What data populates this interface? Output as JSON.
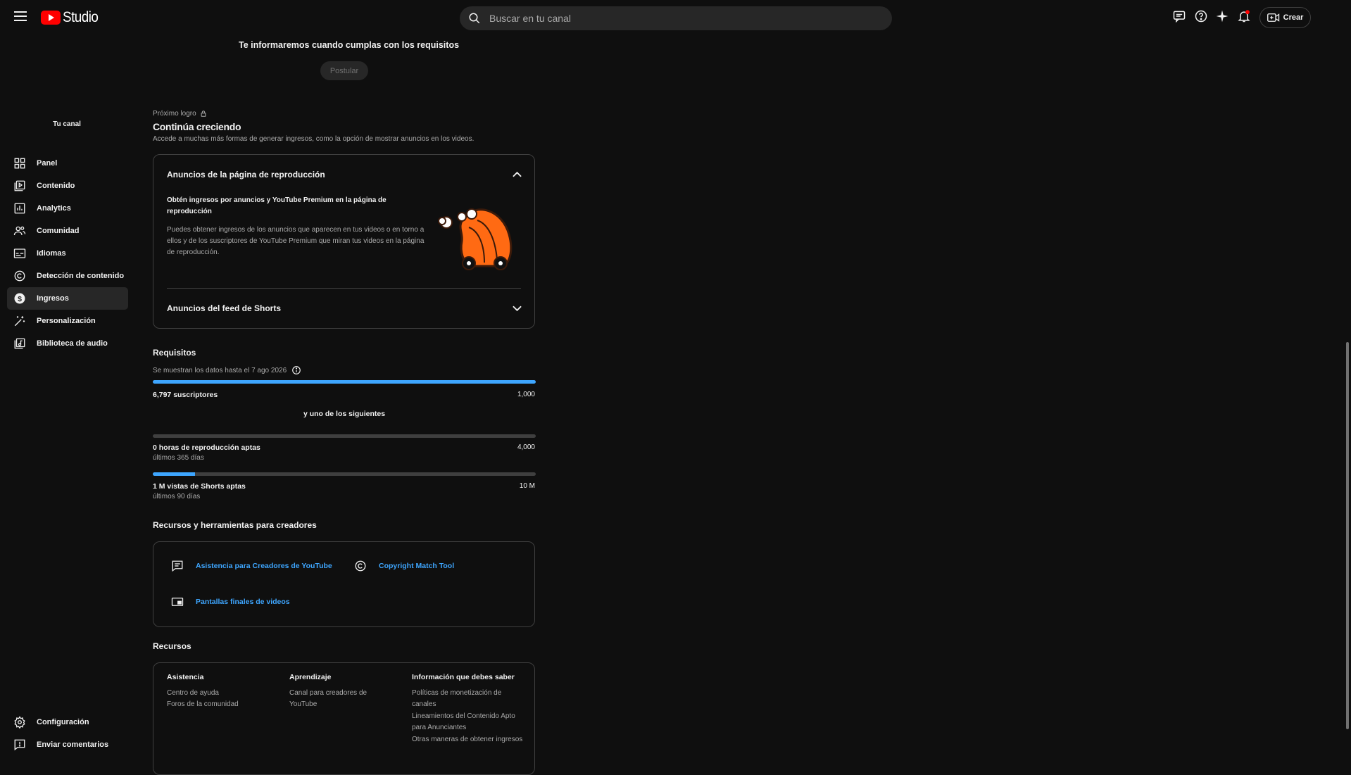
{
  "header": {
    "app_name": "Studio",
    "search_placeholder": "Buscar en tu canal",
    "create_label": "Crear"
  },
  "sidebar": {
    "channel_label": "Tu canal",
    "items": [
      {
        "label": "Panel",
        "icon": "dashboard-icon"
      },
      {
        "label": "Contenido",
        "icon": "content-icon"
      },
      {
        "label": "Analytics",
        "icon": "analytics-icon"
      },
      {
        "label": "Comunidad",
        "icon": "community-icon"
      },
      {
        "label": "Idiomas",
        "icon": "subtitles-icon"
      },
      {
        "label": "Detección de contenido",
        "icon": "copyright-icon"
      },
      {
        "label": "Ingresos",
        "icon": "dollar-icon"
      },
      {
        "label": "Personalización",
        "icon": "magic-wand-icon"
      },
      {
        "label": "Biblioteca de audio",
        "icon": "audio-library-icon"
      }
    ],
    "bottom": [
      {
        "label": "Configuración",
        "icon": "gear-icon"
      },
      {
        "label": "Enviar comentarios",
        "icon": "feedback-icon"
      }
    ]
  },
  "main": {
    "notice": "Te informaremos cuando cumplas con los requisitos",
    "apply_label": "Postular",
    "milestone": {
      "eyebrow": "Próximo logro",
      "title": "Continúa creciendo",
      "description": "Accede a muchas más formas de generar ingresos, como la opción de mostrar anuncios en los videos."
    },
    "accordion": {
      "watch_ads": {
        "title": "Anuncios de la página de reproducción",
        "subtitle": "Obtén ingresos por anuncios y YouTube Premium en la página de reproducción",
        "body": "Puedes obtener ingresos de los anuncios que aparecen en tus videos o en torno a ellos y de los suscriptores de YouTube Premium que miran tus videos en la página de reproducción."
      },
      "shorts_ads": {
        "title": "Anuncios del feed de Shorts"
      }
    },
    "requirements": {
      "title": "Requisitos",
      "data_note": "Se muestran los datos hasta el 7 ago 2026",
      "subscribers": {
        "label": "6,797 suscriptores",
        "target": "1,000",
        "progress": 1.0
      },
      "either_label": "y uno de los siguientes",
      "watch_hours": {
        "label": "0 horas de reproducción aptas",
        "period": "últimos 365 días",
        "target": "4,000",
        "progress": 0.0
      },
      "shorts_views": {
        "label": "1 M vistas de Shorts aptas",
        "period": "últimos 90 días",
        "target": "10 M",
        "progress": 0.11
      }
    },
    "tools": {
      "title": "Recursos y herramientas para creadores",
      "items": [
        {
          "label": "Asistencia para Creadores de YouTube",
          "icon": "chat-icon"
        },
        {
          "label": "Copyright Match Tool",
          "icon": "copyright-icon"
        },
        {
          "label": "Pantallas finales de videos",
          "icon": "end-screen-icon"
        }
      ]
    },
    "resources": {
      "title": "Recursos",
      "columns": [
        {
          "heading": "Asistencia",
          "links": [
            "Centro de ayuda",
            "Foros de la comunidad"
          ]
        },
        {
          "heading": "Aprendizaje",
          "links": [
            "Canal para creadores de YouTube"
          ]
        },
        {
          "heading": "Información que debes saber",
          "links": [
            "Políticas de monetización de canales",
            "Lineamientos del Contenido Apto para Anunciantes",
            "Otras maneras de obtener ingresos"
          ]
        }
      ]
    }
  }
}
